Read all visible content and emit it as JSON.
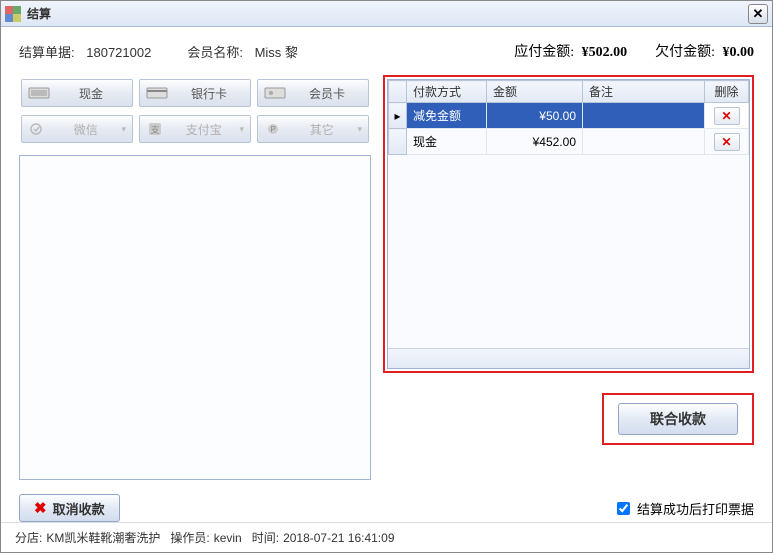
{
  "window": {
    "title": "结算"
  },
  "header": {
    "order_label": "结算单据:",
    "order_no": "180721002",
    "member_label": "会员名称:",
    "member_name": "Miss 黎",
    "due_label": "应付金额:",
    "due_value": "¥502.00",
    "owed_label": "欠付金额:",
    "owed_value": "¥0.00"
  },
  "pay_buttons": {
    "cash": "现金",
    "bank": "银行卡",
    "member": "会员卡",
    "wechat": "微信",
    "alipay": "支付宝",
    "other": "其它"
  },
  "grid": {
    "headers": {
      "method": "付款方式",
      "amount": "金额",
      "remark": "备注",
      "delete": "删除"
    },
    "marker": "▸",
    "rows": [
      {
        "method": "减免金额",
        "amount": "¥50.00",
        "remark": "",
        "selected": true
      },
      {
        "method": "现金",
        "amount": "¥452.00",
        "remark": "",
        "selected": false
      }
    ]
  },
  "buttons": {
    "confirm": "联合收款",
    "cancel": "取消收款"
  },
  "print_checkbox": {
    "label": "结算成功后打印票据",
    "checked": true
  },
  "status": {
    "store_label": "分店:",
    "store": "KM凯米鞋靴潮奢洗护",
    "operator_label": "操作员:",
    "operator": "kevin",
    "time_label": "时间:",
    "time": "2018-07-21 16:41:09"
  }
}
